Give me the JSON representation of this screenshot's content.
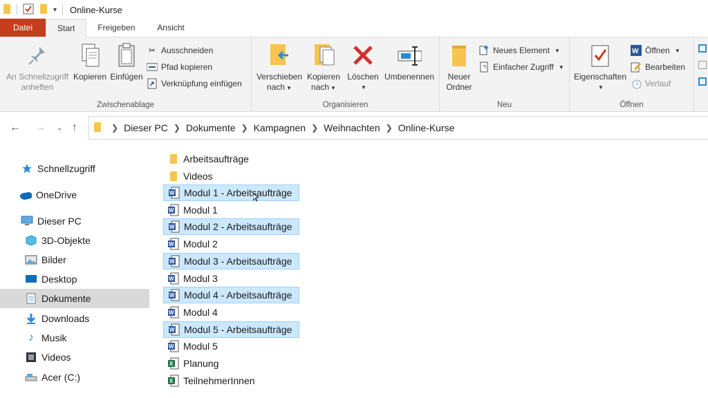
{
  "window": {
    "title": "Online-Kurse"
  },
  "tabs": [
    "Datei",
    "Start",
    "Freigeben",
    "Ansicht"
  ],
  "ribbon": {
    "clipboard": {
      "label": "Zwischenablage",
      "pin_line1": "An Schnellzugriff",
      "pin_line2": "anheften",
      "copy": "Kopieren",
      "paste": "Einfügen",
      "cut": "Ausschneiden",
      "copy_path": "Pfad kopieren",
      "paste_shortcut": "Verknüpfung einfügen"
    },
    "organize": {
      "label": "Organisieren",
      "move_line1": "Verschieben",
      "move_line2": "nach",
      "copyto_line1": "Kopieren",
      "copyto_line2": "nach",
      "delete": "Löschen",
      "rename": "Umbenennen"
    },
    "new": {
      "label": "Neu",
      "folder_line1": "Neuer",
      "folder_line2": "Ordner",
      "new_item": "Neues Element",
      "easy_access": "Einfacher Zugriff"
    },
    "open": {
      "label": "Öffnen",
      "properties": "Eigenschaften",
      "open": "Öffnen",
      "edit": "Bearbeiten",
      "history": "Verlauf"
    }
  },
  "breadcrumb": [
    "Dieser PC",
    "Dokumente",
    "Kampagnen",
    "Weihnachten",
    "Online-Kurse"
  ],
  "nav": [
    {
      "label": "Schnellzugriff",
      "icon": "star-icon"
    },
    {
      "label": "OneDrive",
      "icon": "cloud-icon"
    },
    {
      "label": "Dieser PC",
      "icon": "computer-icon"
    },
    {
      "label": "3D-Objekte",
      "icon": "cube-icon"
    },
    {
      "label": "Bilder",
      "icon": "pictures-icon"
    },
    {
      "label": "Desktop",
      "icon": "desktop-icon"
    },
    {
      "label": "Dokumente",
      "icon": "documents-icon"
    },
    {
      "label": "Downloads",
      "icon": "download-icon"
    },
    {
      "label": "Musik",
      "icon": "music-icon"
    },
    {
      "label": "Videos",
      "icon": "film-icon"
    },
    {
      "label": "Acer (C:)",
      "icon": "drive-icon"
    }
  ],
  "files": [
    {
      "name": "Arbeitsaufträge",
      "type": "folder"
    },
    {
      "name": "Videos",
      "type": "folder"
    },
    {
      "name": "Modul 1 - Arbeitsaufträge",
      "type": "word",
      "selected": true
    },
    {
      "name": "Modul 1",
      "type": "word"
    },
    {
      "name": "Modul 2 - Arbeitsaufträge",
      "type": "word",
      "selected": true
    },
    {
      "name": "Modul 2",
      "type": "word"
    },
    {
      "name": "Modul 3 - Arbeitsaufträge",
      "type": "word",
      "selected": true
    },
    {
      "name": "Modul 3",
      "type": "word"
    },
    {
      "name": "Modul 4 - Arbeitsaufträge",
      "type": "word",
      "selected": true
    },
    {
      "name": "Modul 4",
      "type": "word"
    },
    {
      "name": "Modul 5 - Arbeitsaufträge",
      "type": "word",
      "selected": true
    },
    {
      "name": "Modul 5",
      "type": "word"
    },
    {
      "name": "Planung",
      "type": "excel"
    },
    {
      "name": "TeilnehmerInnen",
      "type": "excel"
    }
  ],
  "colors": {
    "file_tab": "#c43e1c",
    "selection": "#cce8ff",
    "folder": "#f8c44f",
    "word": "#2b579a",
    "excel": "#217346"
  }
}
